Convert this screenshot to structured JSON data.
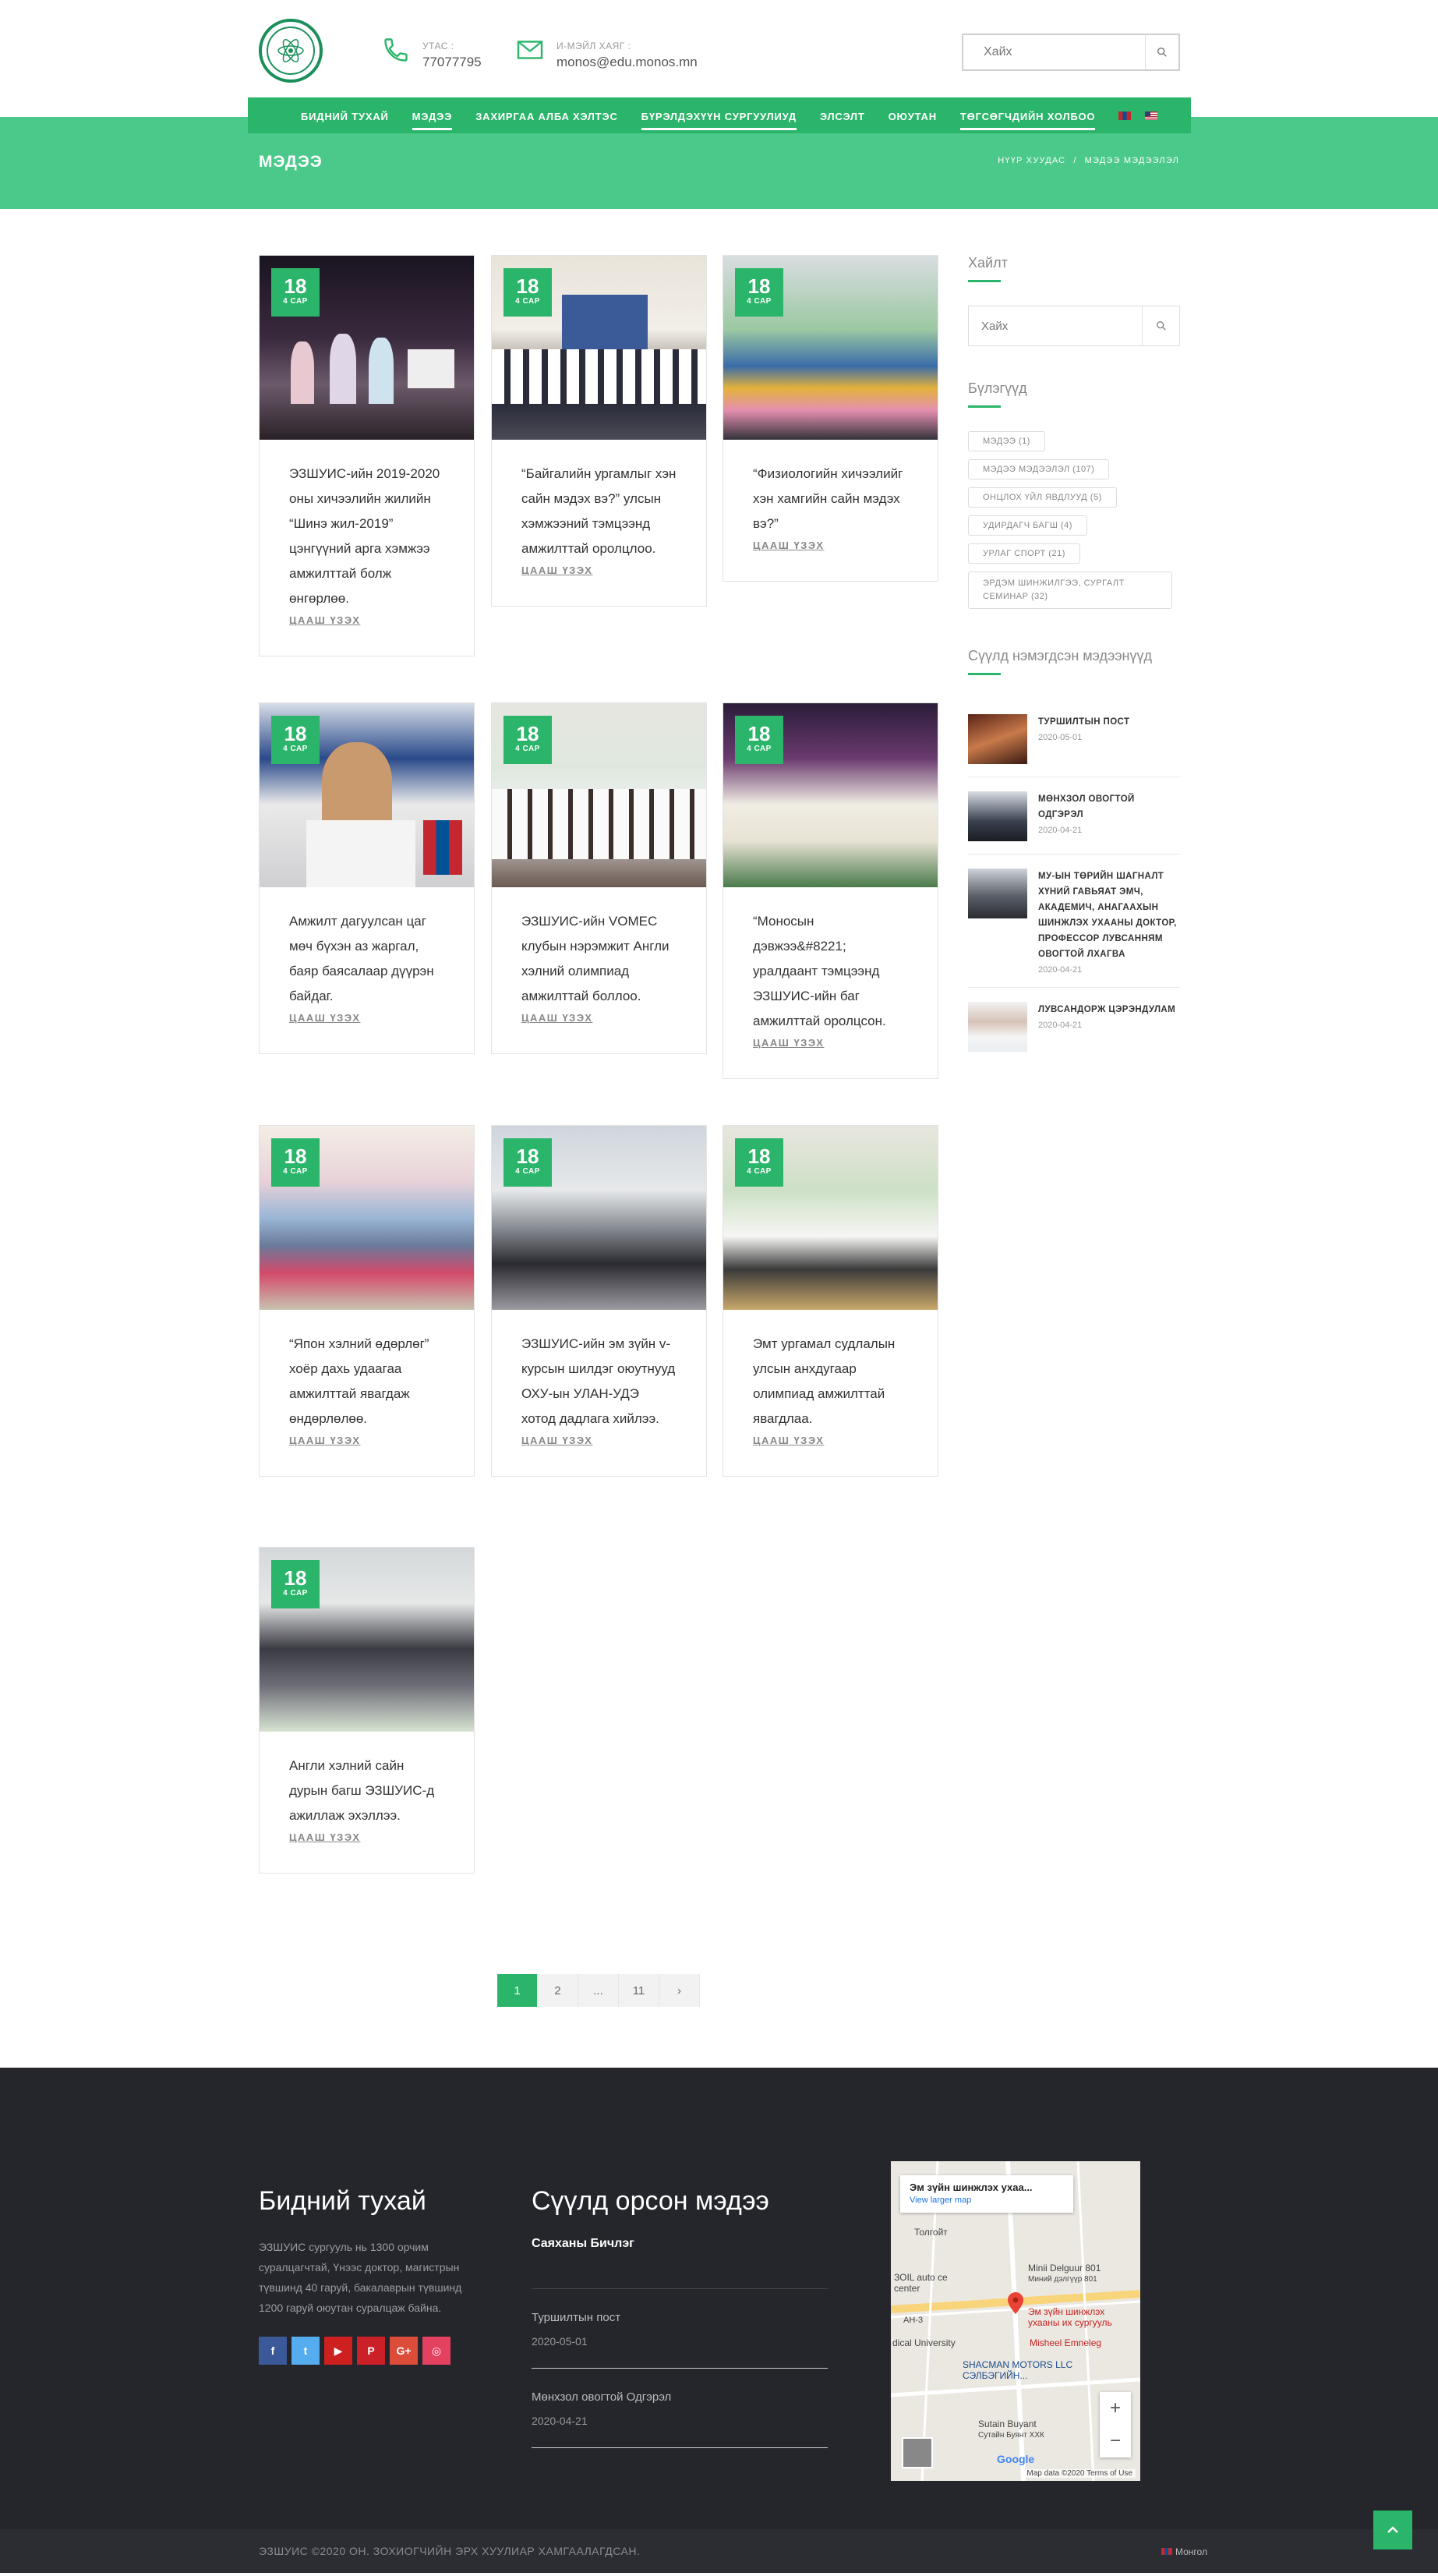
{
  "header": {
    "phone_label": "УТАС :",
    "phone": "77077795",
    "email_label": "И-МЭЙЛ ХАЯГ :",
    "email": "monos@edu.monos.mn",
    "search_placeholder": "Хайх"
  },
  "nav": {
    "items": [
      {
        "label": "БИДНИЙ ТУХАЙ"
      },
      {
        "label": "МЭДЭЭ"
      },
      {
        "label": "ЗАХИРГАА АЛБА ХЭЛТЭС"
      },
      {
        "label": "БҮРЭЛДЭХҮҮН СУРГУУЛИУД"
      },
      {
        "label": "ЭЛСЭЛТ"
      },
      {
        "label": "ОЮУТАН"
      },
      {
        "label": "ТӨГСӨГЧДИЙН ХОЛБОО"
      }
    ]
  },
  "page": {
    "title": "МЭДЭЭ",
    "breadcrumb_home": "НҮҮР ХУУДАС",
    "breadcrumb_sep": "/",
    "breadcrumb_current": "МЭДЭЭ МЭДЭЭЛЭЛ"
  },
  "posts": [
    {
      "day": "18",
      "month": "4 САР",
      "title": "ЭЗШУИС-ийн 2019-2020 оны хичээлийн жилийн “Шинэ жил-2019” цэнгүүний арга хэмжээ амжилттай болж өнгөрлөө.",
      "more": "ЦААШ ҮЗЭХ"
    },
    {
      "day": "18",
      "month": "4 САР",
      "title": "“Байгалийн ургамлыг хэн сайн мэдэх вэ?” улсын хэмжээний тэмцээнд амжилттай оролцлоо.",
      "more": "ЦААШ ҮЗЭХ"
    },
    {
      "day": "18",
      "month": "4 САР",
      "title": "“Физиологийн хичээлийг хэн хамгийн сайн мэдэх вэ?”",
      "more": "ЦААШ ҮЗЭХ"
    },
    {
      "day": "18",
      "month": "4 САР",
      "title": "Амжилт дагуулсан цаг мөч бүхэн аз жаргал, баяр баясалаар дүүрэн байдаг.",
      "more": "ЦААШ ҮЗЭХ"
    },
    {
      "day": "18",
      "month": "4 САР",
      "title": "ЭЗШУИС-ийн VOMEC клубын нэрэмжит Англи хэлний олимпиад амжилттай боллоо.",
      "more": "ЦААШ ҮЗЭХ"
    },
    {
      "day": "18",
      "month": "4 САР",
      "title": "“Моносын дэвжээ&#8221; уралдаант тэмцээнд ЭЗШУИС-ийн баг амжилттай оролцсон.",
      "more": "ЦААШ ҮЗЭХ"
    },
    {
      "day": "18",
      "month": "4 САР",
      "title": "“Япон хэлний өдөрлөг” хоёр дахь удаагаа амжилттай явагдаж өндөрлөлөө.",
      "more": "ЦААШ ҮЗЭХ"
    },
    {
      "day": "18",
      "month": "4 САР",
      "title": "ЭЗШУИС-ийн эм зүйн v-курсын шилдэг оюутнууд ОХУ-ын УЛАН-УДЭ хотод дадлага хийлээ.",
      "more": "ЦААШ ҮЗЭХ"
    },
    {
      "day": "18",
      "month": "4 САР",
      "title": "Эмт ургамал судлалын улсын анхдугаар олимпиад амжилттай явагдлаа.",
      "more": "ЦААШ ҮЗЭХ"
    },
    {
      "day": "18",
      "month": "4 САР",
      "title": "Англи хэлний сайн дурын багш ЭЗШУИС-д ажиллаж эхэллээ.",
      "more": "ЦААШ ҮЗЭХ"
    }
  ],
  "sidebar": {
    "search_title": "Хайлт",
    "search_placeholder": "Хайх",
    "categories_title": "Бүлэгүүд",
    "categories": [
      "МЭДЭЭ (1)",
      "МЭДЭЭ МЭДЭЭЛЭЛ (107)",
      "ОНЦЛОХ ҮЙЛ ЯВДЛУУД (5)",
      "УДИРДАГЧ БАГШ (4)",
      "УРЛАГ СПОРТ (21)",
      "ЭРДЭМ ШИНЖИЛГЭЭ, СУРГАЛТ СЕМИНАР (32)"
    ],
    "recent_title": "Сүүлд нэмэгдсэн мэдээнүүд",
    "recent": [
      {
        "title": "ТУРШИЛТЫН ПОСТ",
        "date": "2020-05-01"
      },
      {
        "title": "МӨНХЗОЛ ОВОГТОЙ ОДГЭРЭЛ",
        "date": "2020-04-21"
      },
      {
        "title": "МУ-ЫН ТӨРИЙН ШАГНАЛТ ХҮНИЙ ГАВЬЯАТ ЭМЧ, АКАДЕМИЧ, АНАГААХЫН ШИНЖЛЭХ УХААНЫ ДОКТОР, ПРОФЕССОР ЛУВСАННЯМ ОВОГТОЙ ЛХАГВА",
        "date": "2020-04-21"
      },
      {
        "title": "ЛУВСАНДОРЖ ЦЭРЭНДУЛАМ",
        "date": "2020-04-21"
      }
    ]
  },
  "pagination": [
    "1",
    "2",
    "...",
    "11",
    "›"
  ],
  "footer": {
    "about_title": "Бидний тухай",
    "about_text": "ЭЗШУИС сургууль нь 1300 орчим суралцагчтай, Үнээс доктор, магистрын түвшинд 40 гаруй, бакалаврын түвшинд 1200 гаруй оюутан суралцаж байна.",
    "social": [
      "f",
      "t",
      "▶",
      "P",
      "G+",
      "◎"
    ],
    "news_title": "Сүүлд орсон мэдээ",
    "news_author": "Саяханы Бичлэг",
    "news": [
      {
        "title": "Туршилтын пост",
        "date": "2020-05-01"
      },
      {
        "title": "Мөнхзол овогтой Одгэрэл",
        "date": "2020-04-21"
      }
    ],
    "map": {
      "popup_title": "Эм зүйн шинжлэх ухаа...",
      "popup_link": "View larger map",
      "labels": [
        "Толгойт",
        "Minii Delguur 801",
        "Миний дэлгүүр 801",
        "ЗОIL auto ce center",
        "Эм зүйн шинжлэх ухааны их сургууль",
        "Misheel Emneleg",
        "dical University",
        "АН-3",
        "SHACMAN MOTORS LLC СЭЛБЭГИЙН...",
        "Sutain Buyant",
        "Сутайн Буянт ХХК"
      ],
      "google": "Google",
      "attribution": "Map data ©2020   Terms of Use"
    },
    "copyright": "ЭЗШУИС ©2020 ОН. ЗОХИОГЧИЙН ЭРХ ХУУЛИАР ХАМГААЛАГДСАН.",
    "language": "Монгол"
  },
  "colors": {
    "accent": "#2bb56a",
    "band": "#4bc98a",
    "footer_bg": "#24262b"
  }
}
